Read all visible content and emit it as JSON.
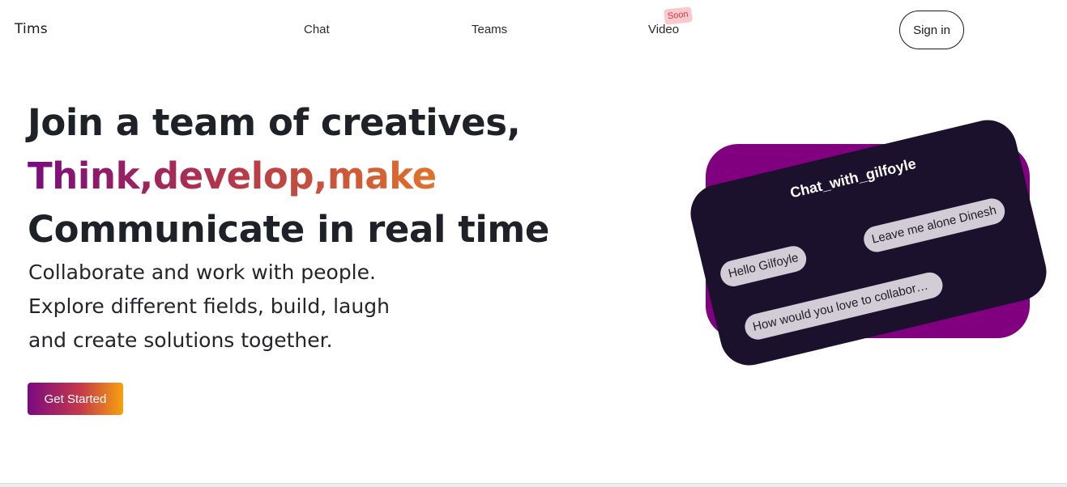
{
  "header": {
    "logo": "Tims",
    "nav": [
      {
        "label": "Chat"
      },
      {
        "label": "Teams"
      },
      {
        "label": "Video",
        "badge": "Soon"
      }
    ],
    "signin_label": "Sign in"
  },
  "hero": {
    "line1": "Join a team of creatives,",
    "line2": "Think,develop,make",
    "line3": "Communicate in real time",
    "sub1": "Collaborate and work with people.",
    "sub2": "Explore different fields, build, laugh",
    "sub3": "and create solutions together.",
    "cta_label": "Get Started"
  },
  "chat_card": {
    "title": "Chat_with_gilfoyle",
    "messages": [
      "Hello Gilfoyle",
      "Leave me alone Dinesh",
      "How would you love to collaborate on a project?"
    ]
  },
  "colors": {
    "brand_purple": "#800080",
    "card_dark": "#1c112d",
    "bubble": "#d1ccd6",
    "gradient_end": "#f7a10d",
    "badge_bg": "#f9c9cc",
    "badge_text": "#d23a44"
  }
}
